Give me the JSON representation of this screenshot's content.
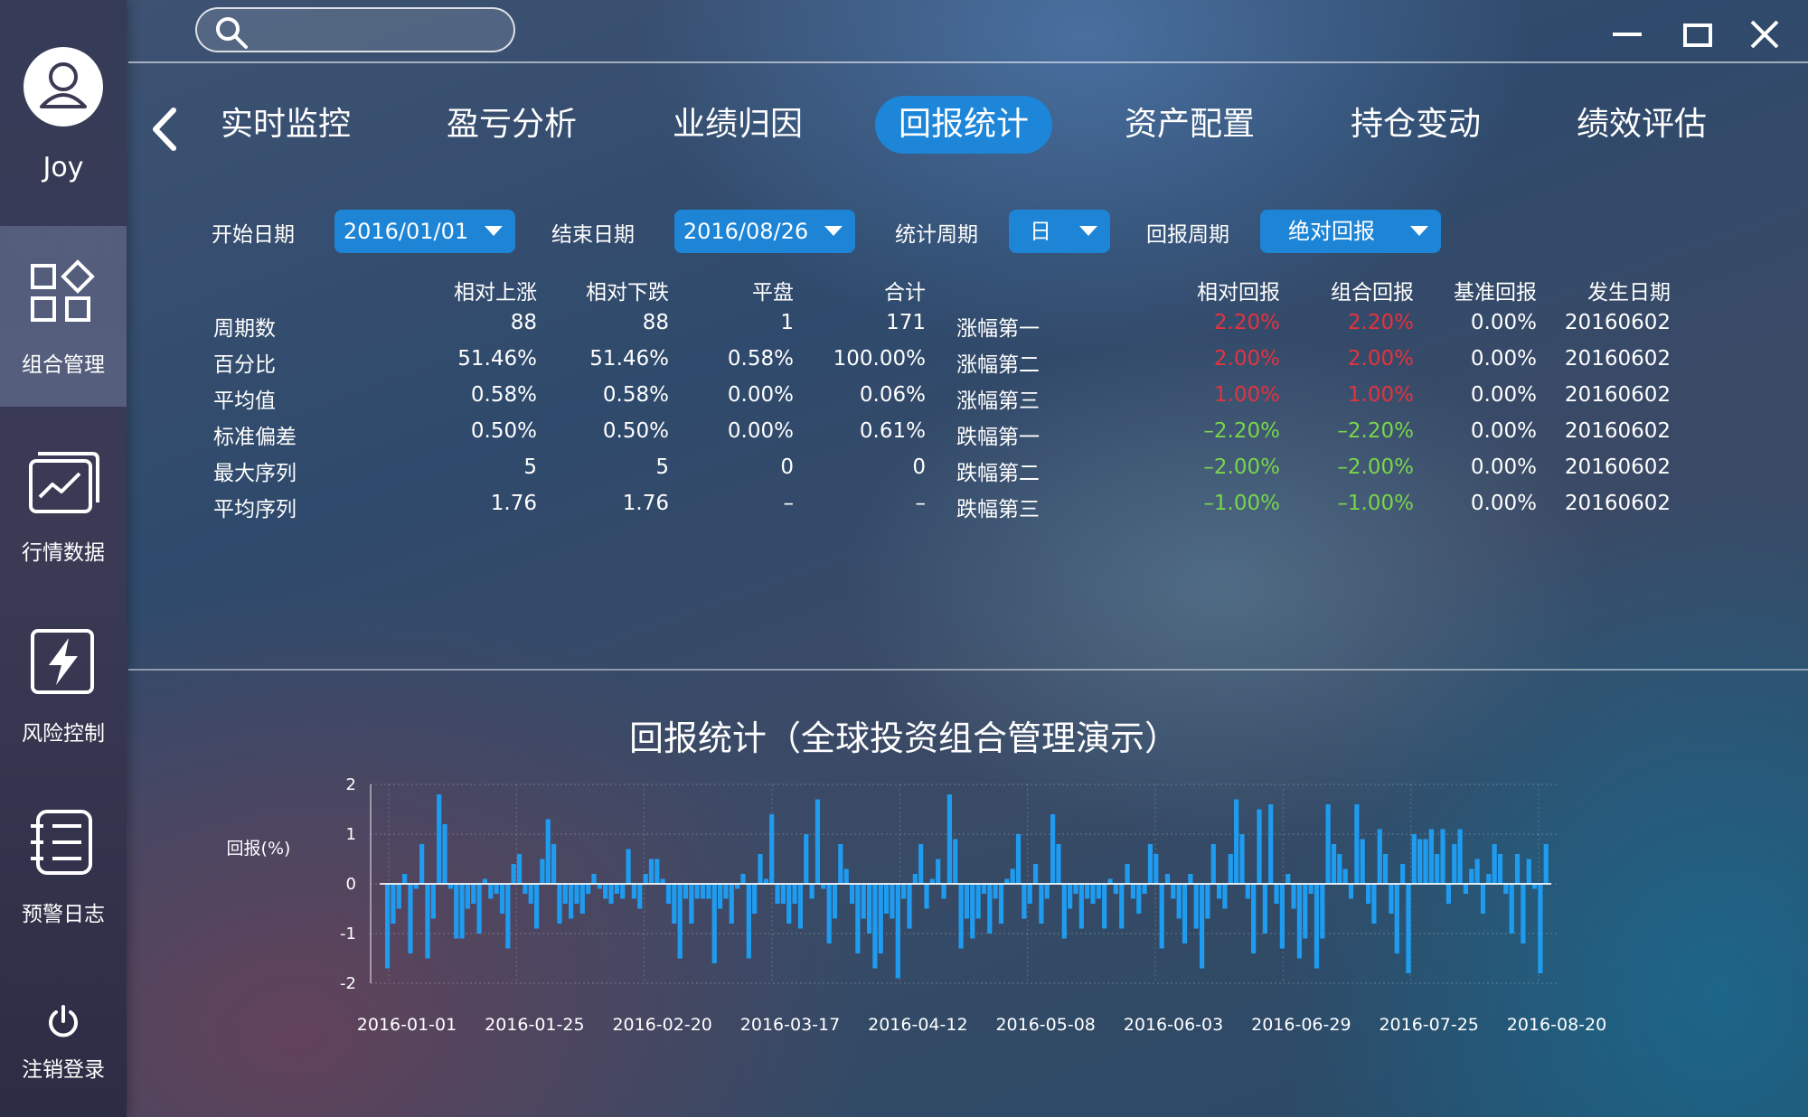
{
  "user": {
    "name": "Joy"
  },
  "sidebar": {
    "items": [
      {
        "label": "组合管理",
        "icon": "portfolio-grid-icon",
        "active": true
      },
      {
        "label": "行情数据",
        "icon": "market-chart-icon",
        "active": false
      },
      {
        "label": "风险控制",
        "icon": "lightning-icon",
        "active": false
      },
      {
        "label": "预警日志",
        "icon": "list-log-icon",
        "active": false
      }
    ],
    "logout": {
      "label": "注销登录",
      "icon": "power-icon"
    }
  },
  "search": {
    "placeholder": ""
  },
  "tabs": [
    {
      "label": "实时监控",
      "active": false
    },
    {
      "label": "盈亏分析",
      "active": false
    },
    {
      "label": "业绩归因",
      "active": false
    },
    {
      "label": "回报统计",
      "active": true
    },
    {
      "label": "资产配置",
      "active": false
    },
    {
      "label": "持仓变动",
      "active": false
    },
    {
      "label": "绩效评估",
      "active": false
    }
  ],
  "filters": {
    "start_label": "开始日期",
    "start_value": "2016/01/01",
    "end_label": "结束日期",
    "end_value": "2016/08/26",
    "period_label": "统计周期",
    "period_value": "日",
    "return_label": "回报周期",
    "return_value": "绝对回报"
  },
  "stats_left": {
    "headers": [
      "相对上涨",
      "相对下跌",
      "平盘",
      "合计"
    ],
    "rows": [
      {
        "label": "周期数",
        "values": [
          "88",
          "88",
          "1",
          "171"
        ]
      },
      {
        "label": "百分比",
        "values": [
          "51.46%",
          "51.46%",
          "0.58%",
          "100.00%"
        ]
      },
      {
        "label": "平均值",
        "values": [
          "0.58%",
          "0.58%",
          "0.00%",
          "0.06%"
        ]
      },
      {
        "label": "标准偏差",
        "values": [
          "0.50%",
          "0.50%",
          "0.00%",
          "0.61%"
        ]
      },
      {
        "label": "最大序列",
        "values": [
          "5",
          "5",
          "0",
          "0"
        ]
      },
      {
        "label": "平均序列",
        "values": [
          "1.76",
          "1.76",
          "–",
          "–"
        ]
      }
    ]
  },
  "stats_right": {
    "headers": [
      "相对回报",
      "组合回报",
      "基准回报",
      "发生日期"
    ],
    "rows": [
      {
        "label": "涨幅第一",
        "rel": "2.20%",
        "port": "2.20%",
        "bench": "0.00%",
        "date": "20160602",
        "dir": "up"
      },
      {
        "label": "涨幅第二",
        "rel": "2.00%",
        "port": "2.00%",
        "bench": "0.00%",
        "date": "20160602",
        "dir": "up"
      },
      {
        "label": "涨幅第三",
        "rel": "1.00%",
        "port": "1.00%",
        "bench": "0.00%",
        "date": "20160602",
        "dir": "up"
      },
      {
        "label": "跌幅第一",
        "rel": "–2.20%",
        "port": "–2.20%",
        "bench": "0.00%",
        "date": "20160602",
        "dir": "down"
      },
      {
        "label": "跌幅第二",
        "rel": "–2.00%",
        "port": "–2.00%",
        "bench": "0.00%",
        "date": "20160602",
        "dir": "down"
      },
      {
        "label": "跌幅第三",
        "rel": "–1.00%",
        "port": "–1.00%",
        "bench": "0.00%",
        "date": "20160602",
        "dir": "down"
      }
    ]
  },
  "colors": {
    "accent": "#1e86d9",
    "up": "#e2333f",
    "down": "#78d64a",
    "bar": "#1f9cf0"
  },
  "chart_data": {
    "type": "bar",
    "title": "回报统计（全球投资组合管理演示）",
    "ylabel": "回报(%)",
    "xlabel": "",
    "ylim": [
      -2,
      2
    ],
    "yticks": [
      2,
      1,
      0,
      -1,
      -2
    ],
    "xtick_labels": [
      "2016-01-01",
      "2016-01-25",
      "2016-02-20",
      "2016-03-17",
      "2016-04-12",
      "2016-05-08",
      "2016-06-03",
      "2016-06-29",
      "2016-07-25",
      "2016-08-20"
    ],
    "grid": true,
    "values": [
      -1.7,
      -0.8,
      -0.5,
      0.2,
      -1.4,
      -0.1,
      0.8,
      -1.5,
      -0.7,
      1.8,
      1.2,
      -0.1,
      -1.1,
      -1.1,
      -0.5,
      -0.4,
      -1.0,
      0.1,
      -0.3,
      -0.2,
      -0.6,
      -1.3,
      0.4,
      0.6,
      -0.2,
      -0.4,
      -0.9,
      0.5,
      1.3,
      0.8,
      -0.8,
      -0.4,
      -0.7,
      -0.4,
      -0.6,
      -0.2,
      0.2,
      -0.1,
      -0.3,
      -0.4,
      -0.2,
      -0.3,
      0.7,
      -0.3,
      -0.5,
      0.2,
      0.5,
      0.5,
      0.1,
      -0.4,
      -0.8,
      -1.5,
      -0.3,
      -0.8,
      -0.3,
      -0.3,
      -0.3,
      -1.6,
      -0.5,
      -0.3,
      -0.8,
      -0.1,
      0.2,
      -1.5,
      -0.6,
      0.6,
      0.1,
      1.4,
      -0.4,
      -0.4,
      -0.8,
      -0.4,
      -0.9,
      1.0,
      -0.3,
      1.7,
      -0.1,
      -1.2,
      -0.7,
      0.8,
      0.3,
      -0.4,
      -1.4,
      -0.7,
      -1.0,
      -1.7,
      -1.4,
      -0.6,
      -0.7,
      -1.9,
      -0.3,
      -0.9,
      0.2,
      0.8,
      -0.5,
      0.1,
      0.5,
      -0.3,
      1.8,
      0.9,
      -1.3,
      -0.7,
      -1.1,
      -0.7,
      -0.2,
      -1.0,
      -0.3,
      -0.8,
      0.1,
      0.3,
      1.0,
      -0.7,
      -0.4,
      0.4,
      -0.8,
      -0.3,
      1.4,
      0.8,
      -1.1,
      -0.5,
      -0.2,
      -0.9,
      -0.3,
      -0.4,
      -0.3,
      -0.9,
      0.1,
      -0.2,
      -0.9,
      0.4,
      -0.3,
      -0.6,
      -0.2,
      0.8,
      0.6,
      -1.3,
      0.2,
      -0.3,
      -0.7,
      -1.2,
      0.2,
      -0.9,
      -1.7,
      -0.7,
      0.8,
      -0.3,
      -0.5,
      0.6,
      1.7,
      1.0,
      -0.3,
      -1.4,
      1.5,
      -1.0,
      1.6,
      -0.4,
      -1.3,
      0.2,
      -0.5,
      -1.5,
      -1.1,
      -0.2,
      -1.7,
      -1.1,
      1.6,
      0.8,
      0.6,
      0.3,
      -0.3,
      1.6,
      0.9,
      -0.4,
      -0.8,
      1.1,
      0.6,
      -0.6,
      -1.4,
      0.4,
      -1.8,
      1.0,
      0.9,
      0.9,
      1.1,
      0.6,
      1.1,
      -0.4,
      0.8,
      1.1,
      -0.2,
      0.3,
      0.5,
      -0.6,
      0.2,
      0.8,
      0.6,
      -0.2,
      -1.0,
      0.6,
      -1.2,
      0.5,
      -0.1,
      -1.8,
      0.8
    ]
  }
}
